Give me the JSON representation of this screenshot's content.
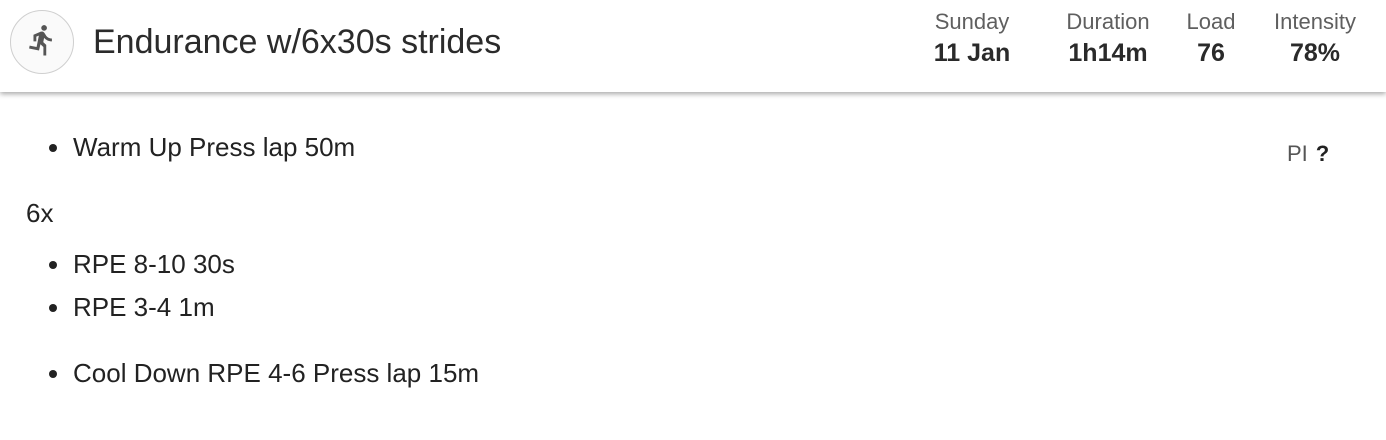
{
  "workout": {
    "icon": "running-person-icon",
    "title": "Endurance w/6x30s strides"
  },
  "stats": {
    "day": {
      "label": "Sunday",
      "value": "11 Jan"
    },
    "duration": {
      "label": "Duration",
      "value": "1h14m"
    },
    "load": {
      "label": "Load",
      "value": "76"
    },
    "intensity": {
      "label": "Intensity",
      "value": "78%"
    }
  },
  "steps": {
    "warmup": "Warm Up Press lap 50m",
    "repeat_label": "6x",
    "interval_1": "RPE 8-10 30s",
    "interval_2": "RPE 3-4 1m",
    "cooldown": "Cool Down RPE 4-6 Press lap 15m"
  },
  "pi": {
    "label": "PI",
    "help": "?"
  }
}
